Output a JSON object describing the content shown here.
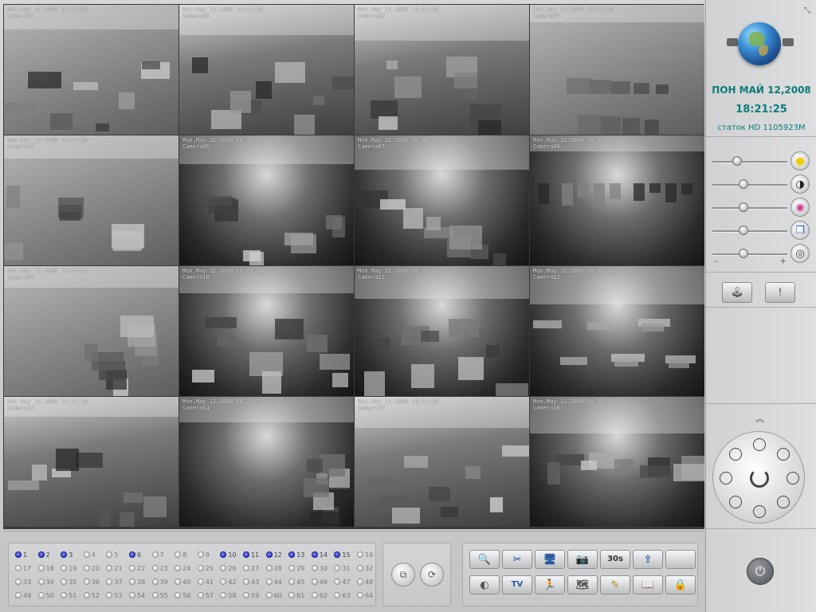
{
  "cameras": [
    {
      "id": 1,
      "osd": "Mon.May 12.2008 18:21:26\nCamera01",
      "active": false,
      "tone": "light"
    },
    {
      "id": 2,
      "osd": "Mon.May 12.2008 18:21:26\nCamera02",
      "active": true,
      "tone": "mid"
    },
    {
      "id": 3,
      "osd": "Mon.May 12.2008 18:21:26\nCamera03",
      "active": false,
      "tone": "mid"
    },
    {
      "id": 4,
      "osd": "Mon.May 12.2008 18:21:26\nCamera04",
      "active": false,
      "tone": "light"
    },
    {
      "id": 5,
      "osd": "Mon.May 12.2008 18:21:26\nCamera05",
      "active": false,
      "tone": "light"
    },
    {
      "id": 6,
      "osd": "Mon.May 12.2008 18:21:26\nCamera06",
      "active": false,
      "tone": "dark"
    },
    {
      "id": 7,
      "osd": "Mon.May 12.2008 18:21:26\nCamera07",
      "active": false,
      "tone": "dark"
    },
    {
      "id": 8,
      "osd": "Mon.May 12.2008 18:21:26\nCamera08",
      "active": false,
      "tone": "dark"
    },
    {
      "id": 9,
      "osd": "Mon.May 12.2008 18:21:26\nCamera09",
      "active": false,
      "tone": "light"
    },
    {
      "id": 10,
      "osd": "Mon.May 12.2008 18:21:26\nCamera10",
      "active": false,
      "tone": "dark"
    },
    {
      "id": 11,
      "osd": "Mon.May 12.2008 18:21:26\nCamera11",
      "active": false,
      "tone": "dark"
    },
    {
      "id": 12,
      "osd": "Mon.May 12.2008 18:21:26\nCamera12",
      "active": false,
      "tone": "dark"
    },
    {
      "id": 13,
      "osd": "Mon.May 12.2008 18:21:26\nCamera13",
      "active": false,
      "tone": "mid"
    },
    {
      "id": 14,
      "osd": "Mon.May 12.2008 18:21:26\nCamera14",
      "active": false,
      "tone": "dark"
    },
    {
      "id": 15,
      "osd": "Mon.May 12.2008 18:21:26\nCamera15",
      "active": false,
      "tone": "mid"
    },
    {
      "id": 16,
      "osd": "Mon.May 12.2008 18:21:26\nCamera16",
      "active": false,
      "tone": "dark"
    }
  ],
  "status": {
    "date": "ПОН  МАЙ 12,2008",
    "time": "18:21:25",
    "hd": "статок HD  1105923M"
  },
  "sliders": [
    {
      "name": "brightness",
      "icon": "brightness-icon",
      "level": 0.33,
      "glyph": "●",
      "color": "#f0d000"
    },
    {
      "name": "contrast",
      "icon": "contrast-icon",
      "level": 0.42,
      "glyph": "◑",
      "color": "#222222"
    },
    {
      "name": "color",
      "icon": "color-wheel-icon",
      "level": 0.42,
      "glyph": "◉",
      "color": "#d03a8a"
    },
    {
      "name": "saturation",
      "icon": "saturation-icon",
      "level": 0.42,
      "glyph": "❐",
      "color": "#2f5fd0"
    },
    {
      "name": "zoom",
      "icon": "zoom-focus-icon",
      "level": 0.42,
      "glyph": "◎",
      "color": "#333333"
    }
  ],
  "slider_minus": "–",
  "slider_plus": "+",
  "side_buttons": [
    {
      "name": "joystick-button",
      "icon": "joystick-icon",
      "glyph": "🕹"
    },
    {
      "name": "alarm-button",
      "icon": "alert-icon",
      "glyph": "!"
    }
  ],
  "ptz_up": "︽",
  "channels": {
    "on": [
      1,
      2,
      3,
      6,
      10,
      11,
      12,
      13,
      14,
      15
    ],
    "labels": [
      "1",
      "2",
      "3",
      "4",
      "5",
      "6",
      "7",
      "8",
      "9",
      "10",
      "11",
      "12",
      "13",
      "14",
      "15",
      "16",
      "17",
      "18",
      "19",
      "20",
      "21",
      "22",
      "23",
      "24",
      "25",
      "26",
      "27",
      "28",
      "29",
      "30",
      "31",
      "32",
      "33",
      "34",
      "35",
      "36",
      "37",
      "38",
      "39",
      "40",
      "41",
      "42",
      "43",
      "44",
      "45",
      "46",
      "47",
      "48",
      "49",
      "50",
      "51",
      "52",
      "53",
      "54",
      "55",
      "56",
      "57",
      "58",
      "59",
      "60",
      "61",
      "62",
      "63",
      "64"
    ]
  },
  "mid_buttons": [
    {
      "name": "split-view-button",
      "icon": "split-view-icon",
      "glyph": "⧉"
    },
    {
      "name": "cycle-view-button",
      "icon": "cycle-icon",
      "glyph": "⟳"
    }
  ],
  "tools": [
    {
      "name": "search-playback-button",
      "icon": "search-playback-icon",
      "glyph": "🔍",
      "color": "#2c5aa0"
    },
    {
      "name": "settings-button",
      "icon": "tools-icon",
      "glyph": "✂",
      "color": "#1f4fa8"
    },
    {
      "name": "monitor-button",
      "icon": "monitor-icon",
      "glyph": "🖥",
      "color": "#2c5aa0"
    },
    {
      "name": "snapshot-button",
      "icon": "camera-icon",
      "glyph": "📷",
      "color": "#333"
    },
    {
      "name": "record-30s-button",
      "icon": "record-30s-icon",
      "glyph": "30s",
      "color": "#333"
    },
    {
      "name": "export-button",
      "icon": "export-icon",
      "glyph": "⇪",
      "color": "#2c5aa0"
    },
    {
      "name": "blank-tool-button",
      "icon": "blank-icon",
      "glyph": "",
      "color": "#333"
    },
    {
      "name": "disk-button",
      "icon": "disk-icon",
      "glyph": "◐",
      "color": "#555"
    },
    {
      "name": "tv-button",
      "icon": "tv-icon",
      "glyph": "TV",
      "color": "#2c5aa0"
    },
    {
      "name": "motion-button",
      "icon": "running-man-icon",
      "glyph": "🏃",
      "color": "#c0261e"
    },
    {
      "name": "network-map-button",
      "icon": "world-map-icon",
      "glyph": "🗺",
      "color": "#555"
    },
    {
      "name": "notes-button",
      "icon": "pencil-note-icon",
      "glyph": "✎",
      "color": "#b08a10"
    },
    {
      "name": "log-book-button",
      "icon": "book-icon",
      "glyph": "📖",
      "color": "#3a8a2a"
    },
    {
      "name": "lock-button",
      "icon": "lock-icon",
      "glyph": "🔒",
      "color": "#c89d15"
    }
  ]
}
